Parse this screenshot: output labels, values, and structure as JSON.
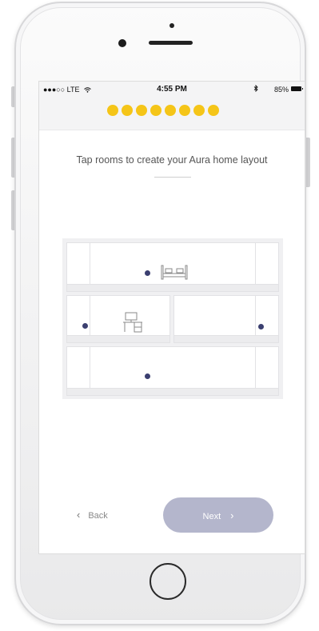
{
  "status_bar": {
    "carrier": "●●●○○ LTE",
    "wifi_icon": "wifi-icon",
    "time": "4:55 PM",
    "bluetooth_icon": "bluetooth-icon",
    "battery": "85%"
  },
  "progress": {
    "steps_completed": 8,
    "total_steps": 8,
    "color": "#f5c518"
  },
  "main": {
    "title": "Tap rooms to create your Aura home layout"
  },
  "house": {
    "rooms": [
      {
        "name": "top floor",
        "icon": "bed-icon"
      },
      {
        "name": "middle left",
        "icon": "desk-icon"
      },
      {
        "name": "middle right",
        "icon": ""
      },
      {
        "name": "bottom floor",
        "icon": ""
      }
    ],
    "marker_color": "#3b3f70"
  },
  "nav": {
    "back_label": "Back",
    "back_chevron": "‹",
    "next_label": "Next",
    "next_chevron": "›",
    "next_color": "#b4b6cc"
  }
}
